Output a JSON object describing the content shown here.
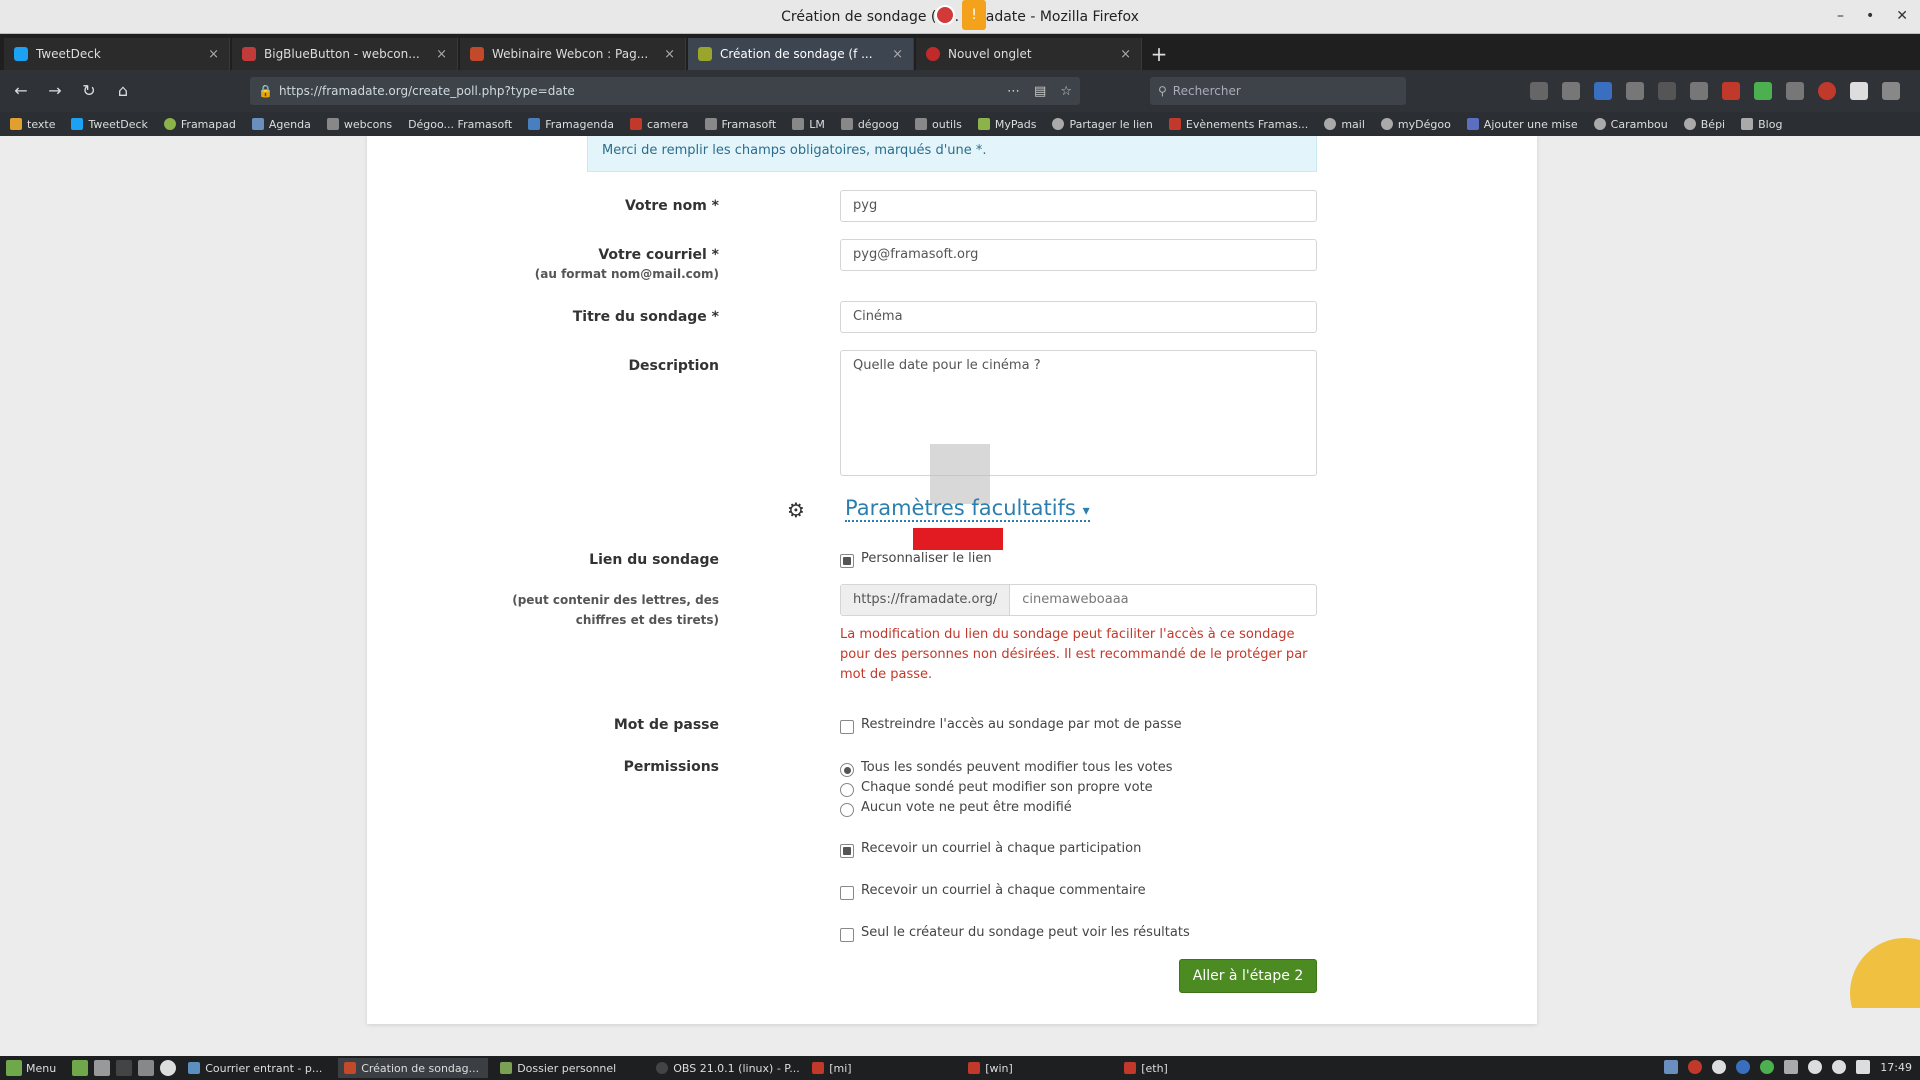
{
  "window": {
    "title": "Création de sondage (f ... amadate - Mozilla Firefox",
    "controls": [
      "–",
      "•",
      "✕"
    ]
  },
  "tabs": [
    {
      "label": "TweetDeck",
      "color": "#1da1f2",
      "active": false
    },
    {
      "label": "BigBlueButton - webcon...",
      "color": "#c23b3b",
      "active": false
    },
    {
      "label": "Webinaire Webcon : Pag...",
      "color": "#c24a2b",
      "active": false
    },
    {
      "label": "Création de sondage (f ...",
      "color": "#9aa52c",
      "active": true
    },
    {
      "label": "Nouvel onglet",
      "color": "#c02a2a",
      "active": false
    }
  ],
  "tab_close": "×",
  "new_tab": "+",
  "nav": {
    "back": "←",
    "forward": "→",
    "reload": "↻",
    "home": "⌂",
    "lock": "🔒",
    "url": "https://framadate.org/create_poll.php?type=date",
    "search_placeholder": "Rechercher",
    "search_glyph": "⚲"
  },
  "bookmarks": [
    {
      "label": "texte",
      "color": "#e0a030"
    },
    {
      "label": "TweetDeck",
      "color": "#1da1f2"
    },
    {
      "label": "Framapad",
      "color": "#8bb34a"
    },
    {
      "label": "Agenda",
      "color": "#6a8fbf"
    },
    {
      "label": "webcons",
      "color": "#888888"
    },
    {
      "label": "Dégoo... Framasoft",
      "color": "#888888"
    },
    {
      "label": "Framagenda",
      "color": "#4a7fbf"
    },
    {
      "label": "camera",
      "color": "#c0392b"
    },
    {
      "label": "Framasoft",
      "color": "#888888"
    },
    {
      "label": "LM",
      "color": "#888888"
    },
    {
      "label": "dégoog",
      "color": "#888888"
    },
    {
      "label": "outils",
      "color": "#888888"
    },
    {
      "label": "MyPads",
      "color": "#8bb34a"
    },
    {
      "label": "Partager le lien",
      "color": "#aaaaaa"
    },
    {
      "label": "Evènements Framas...",
      "color": "#c0392b"
    },
    {
      "label": "mail",
      "color": "#aaaaaa"
    },
    {
      "label": "myDégoo",
      "color": "#aaaaaa"
    },
    {
      "label": "Ajouter une mise",
      "color": "#5a6fbf"
    },
    {
      "label": "Carambou",
      "color": "#aaaaaa"
    },
    {
      "label": "Bépi",
      "color": "#aaaaaa"
    },
    {
      "label": "Blog",
      "color": "#aaaaaa"
    }
  ],
  "form": {
    "notice": "Merci de remplir les champs obligatoires, marqués d'une *.",
    "name_label": "Votre nom *",
    "name_value": "pyg",
    "email_label": "Votre courriel *",
    "email_sublabel": "(au format nom@mail.com)",
    "email_value": "pyg@framasoft.org",
    "title_label": "Titre du sondage *",
    "title_value": "Cinéma",
    "description_label": "Description",
    "description_value": "Quelle date pour le cinéma ?",
    "options_toggle": "Paramètres facultatifs",
    "options_caret": "▾",
    "gear_glyph": "⚙",
    "link_label": "Lien du sondage",
    "link_sublabel_1": "(peut contenir des lettres, des",
    "link_sublabel_2": "chiffres et des tirets)",
    "link_customize": "Personnaliser le lien",
    "link_prefix": "https://framadate.org/",
    "link_slug": "cinemaweboaaa",
    "link_warning": "La modification du lien du sondage peut faciliter l'accès à ce sondage pour des personnes non désirées. Il est recommandé de le protéger par mot de passe.",
    "password_label": "Mot de passe",
    "password_option": "Restreindre l'accès au sondage par mot de passe",
    "permissions_label": "Permissions",
    "perm_all": "Tous les sondés peuvent modifier tous les votes",
    "perm_own": "Chaque sondé peut modifier son propre vote",
    "perm_none": "Aucun vote ne peut être modifié",
    "mail_participation": "Recevoir un courriel à chaque participation",
    "mail_comment": "Recevoir un courriel à chaque commentaire",
    "results_creator_only": "Seul le créateur du sondage peut voir les résultats",
    "next_button": "Aller à l'étape 2"
  },
  "taskbar": {
    "menu": "Menu",
    "tasks": [
      {
        "label": "Courrier entrant - p...",
        "color": "#5a8fbf",
        "active": false
      },
      {
        "label": "Création de sondag...",
        "color": "#c24a2b",
        "active": true
      },
      {
        "label": "Dossier personnel",
        "color": "#7aa055",
        "active": false
      },
      {
        "label": "OBS 21.0.1 (linux) - P...",
        "color": "#444444",
        "active": false
      },
      {
        "label": "[mi]",
        "color": "#c0392b",
        "active": false
      },
      {
        "label": "[win]",
        "color": "#c0392b",
        "active": false
      },
      {
        "label": "[eth]",
        "color": "#c0392b",
        "active": false
      }
    ],
    "clock": "17:49"
  }
}
